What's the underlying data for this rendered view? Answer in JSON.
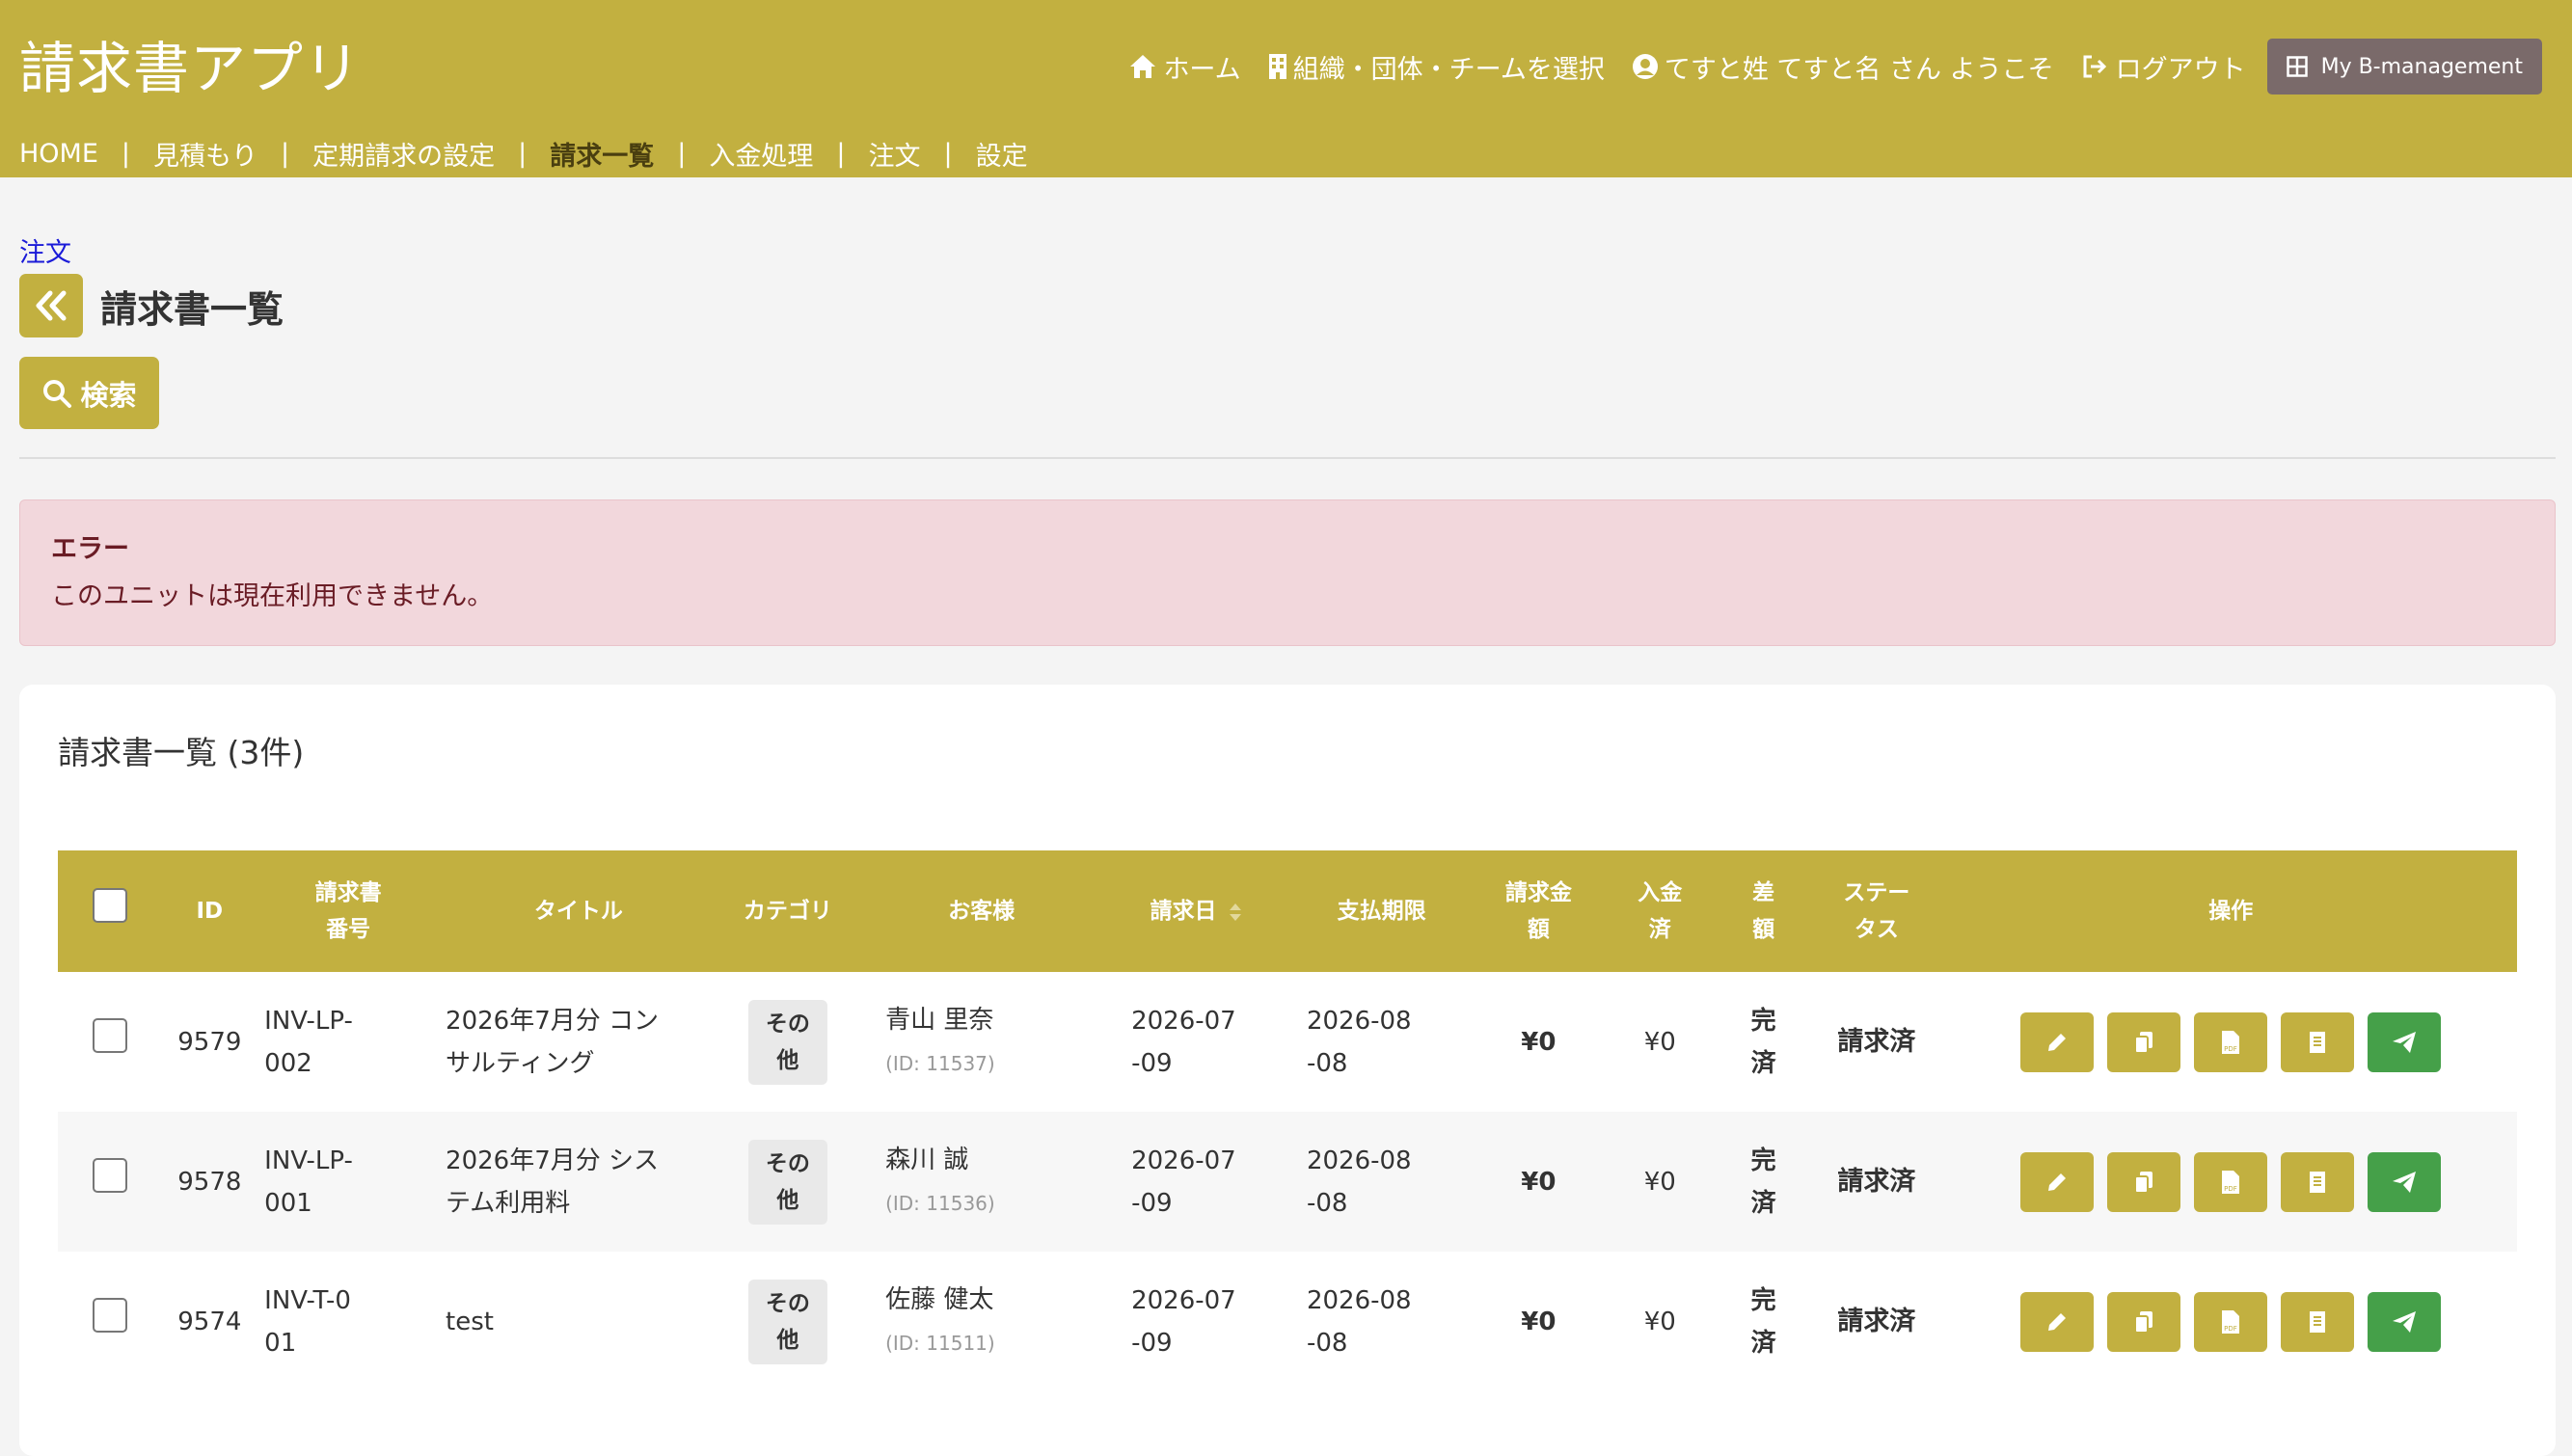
{
  "header": {
    "app_title": "請求書アプリ",
    "nav": {
      "home": "ホーム",
      "org_select": "組織・団体・チームを選択",
      "welcome": "てすと姓 てすと名 さん ようこそ",
      "logout": "ログアウト",
      "my_bm": "My B-management"
    }
  },
  "main_nav": {
    "items": [
      {
        "label": "HOME",
        "active": false
      },
      {
        "label": "見積もり",
        "active": false
      },
      {
        "label": "定期請求の設定",
        "active": false
      },
      {
        "label": "請求一覧",
        "active": true
      },
      {
        "label": "入金処理",
        "active": false
      },
      {
        "label": "注文",
        "active": false
      },
      {
        "label": "設定",
        "active": false
      }
    ]
  },
  "breadcrumb": "注文",
  "page_title": "請求書一覧",
  "search_button": "検索",
  "alert": {
    "title": "エラー",
    "message": "このユニットは現在利用できません。"
  },
  "card_title": "請求書一覧 (3件)",
  "table": {
    "headers": {
      "id": "ID",
      "number": "請求書番号",
      "title": "タイトル",
      "category": "カテゴリ",
      "customer": "お客様",
      "invoice_date": "請求日",
      "due_date": "支払期限",
      "amount": "請求金額",
      "paid": "入金済",
      "diff": "差額",
      "status": "ステータス",
      "ops": "操作"
    },
    "rows": [
      {
        "id": "9579",
        "number": "INV-LP-002",
        "title": "2026年7月分 コンサルティング",
        "category": "その他",
        "customer": "青山 里奈",
        "customer_id": "(ID: 11537)",
        "invoice_date": "2026-07-09",
        "due_date": "2026-08-08",
        "amount": "¥0",
        "paid": "¥0",
        "diff": "完済",
        "status": "請求済"
      },
      {
        "id": "9578",
        "number": "INV-LP-001",
        "title": "2026年7月分 システム利用料",
        "category": "その他",
        "customer": "森川 誠",
        "customer_id": "(ID: 11536)",
        "invoice_date": "2026-07-09",
        "due_date": "2026-08-08",
        "amount": "¥0",
        "paid": "¥0",
        "diff": "完済",
        "status": "請求済"
      },
      {
        "id": "9574",
        "number": "INV-T-001",
        "title": "test",
        "category": "その他",
        "customer": "佐藤 健太",
        "customer_id": "(ID: 11511)",
        "invoice_date": "2026-07-09",
        "due_date": "2026-08-08",
        "amount": "¥0",
        "paid": "¥0",
        "diff": "完済",
        "status": "請求済"
      }
    ]
  },
  "icons": {
    "ops": [
      "pencil-icon",
      "copy-icon",
      "pdf-icon",
      "receipt-icon",
      "send-icon"
    ]
  },
  "colors": {
    "brand": "#c2b040",
    "my_bm_button": "#7a6a6a",
    "status_blue": "#1f3f98",
    "paid_green": "#45a049",
    "alert_bg": "#f2d7dc",
    "link_blue": "#1a1ad8"
  }
}
